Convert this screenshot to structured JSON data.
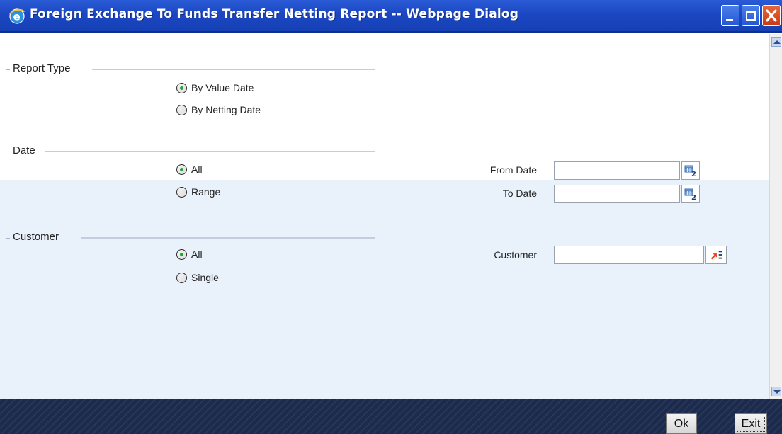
{
  "window": {
    "title": "Foreign Exchange To Funds Transfer Netting Report -- Webpage Dialog",
    "icon": "ie-icon"
  },
  "sections": {
    "report_type": {
      "label": "Report Type",
      "options": [
        "By Value Date",
        "By Netting Date"
      ],
      "selected": "By Value Date"
    },
    "date": {
      "label": "Date",
      "options": [
        "All",
        "Range"
      ],
      "selected": "All",
      "from_label": "From Date",
      "from_value": "",
      "to_label": "To Date",
      "to_value": ""
    },
    "customer": {
      "label": "Customer",
      "options": [
        "All",
        "Single"
      ],
      "selected": "All",
      "field_label": "Customer",
      "field_value": ""
    }
  },
  "buttons": {
    "ok": "Ok",
    "exit": "Exit"
  },
  "colors": {
    "titlebar": "#1c47c2",
    "band": "#e9f1fa",
    "footer": "#1c2b4d",
    "radio_selected": "#22a33a"
  }
}
